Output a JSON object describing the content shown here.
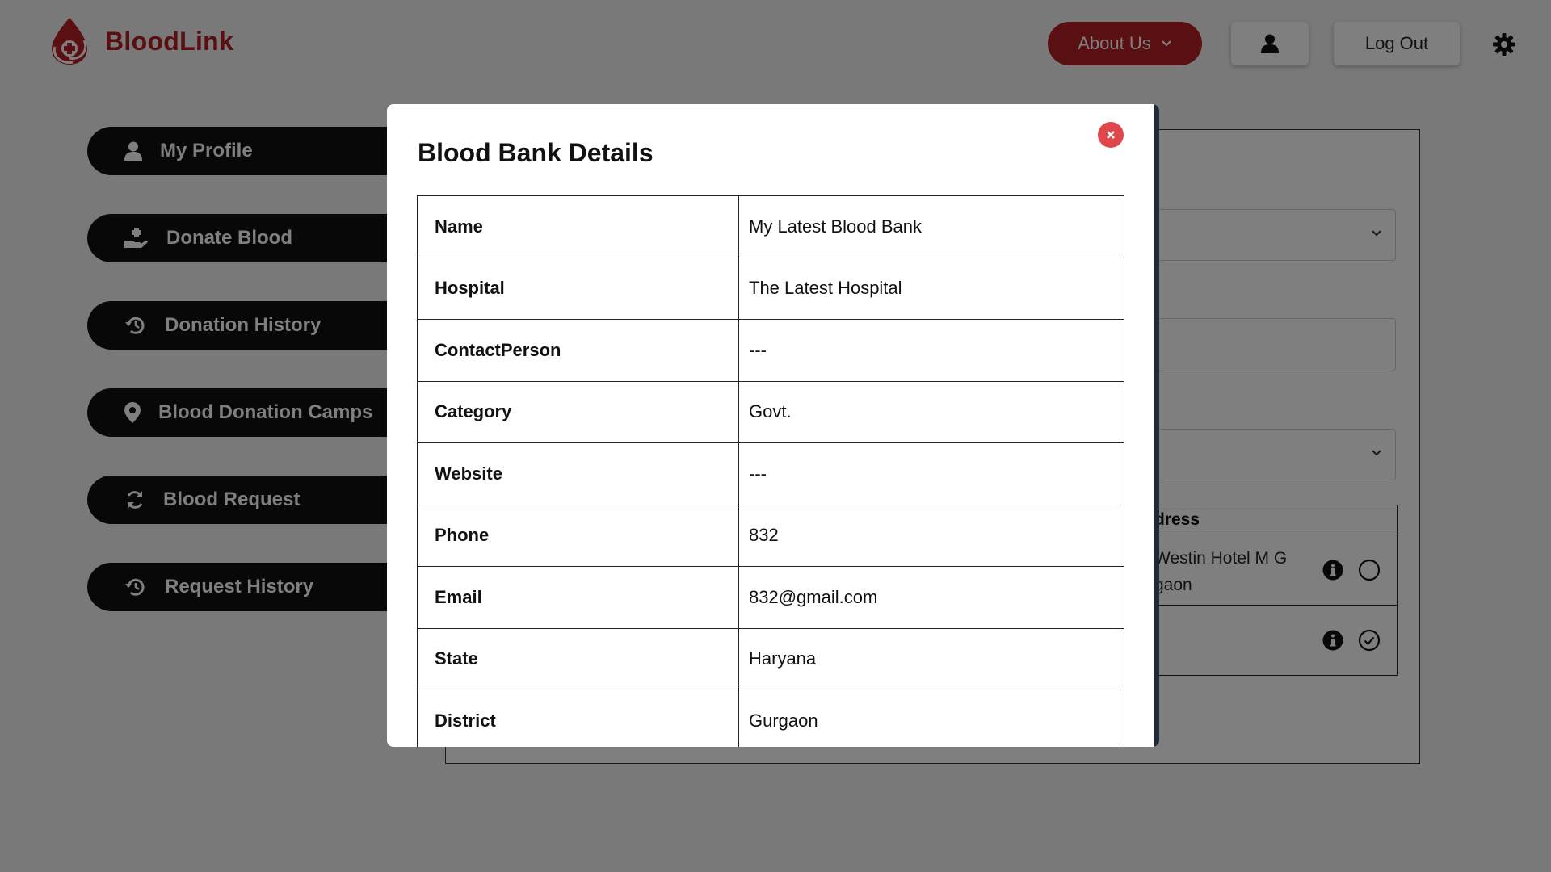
{
  "header": {
    "brand": "BloodLink",
    "about_label": "About Us",
    "logout_label": "Log Out"
  },
  "sidebar": {
    "items": [
      {
        "label": "My Profile",
        "icon": "user-icon"
      },
      {
        "label": "Donate Blood",
        "icon": "hand-donate-icon"
      },
      {
        "label": "Donation History",
        "icon": "history-icon"
      },
      {
        "label": "Blood Donation Camps",
        "icon": "map-pin-icon"
      },
      {
        "label": "Blood Request",
        "icon": "refresh-icon"
      },
      {
        "label": "Request History",
        "icon": "history-icon"
      }
    ]
  },
  "background_table": {
    "header_fragment": "dress",
    "row1_address_line1": "Westin Hotel M G",
    "row1_address_line2": "gaon"
  },
  "modal": {
    "title": "Blood Bank Details",
    "rows": [
      {
        "key": "Name",
        "value": "My Latest Blood Bank"
      },
      {
        "key": "Hospital",
        "value": "The Latest Hospital"
      },
      {
        "key": "ContactPerson",
        "value": "---"
      },
      {
        "key": "Category",
        "value": "Govt."
      },
      {
        "key": "Website",
        "value": "---"
      },
      {
        "key": "Phone",
        "value": "832"
      },
      {
        "key": "Email",
        "value": "832@gmail.com"
      },
      {
        "key": "State",
        "value": "Haryana"
      },
      {
        "key": "District",
        "value": "Gurgaon"
      }
    ]
  },
  "colors": {
    "brand_red": "#b51f24",
    "close_red": "#e0474c",
    "sidebar_bg": "#111111",
    "overlay": "rgba(0,0,0,0.5)"
  }
}
